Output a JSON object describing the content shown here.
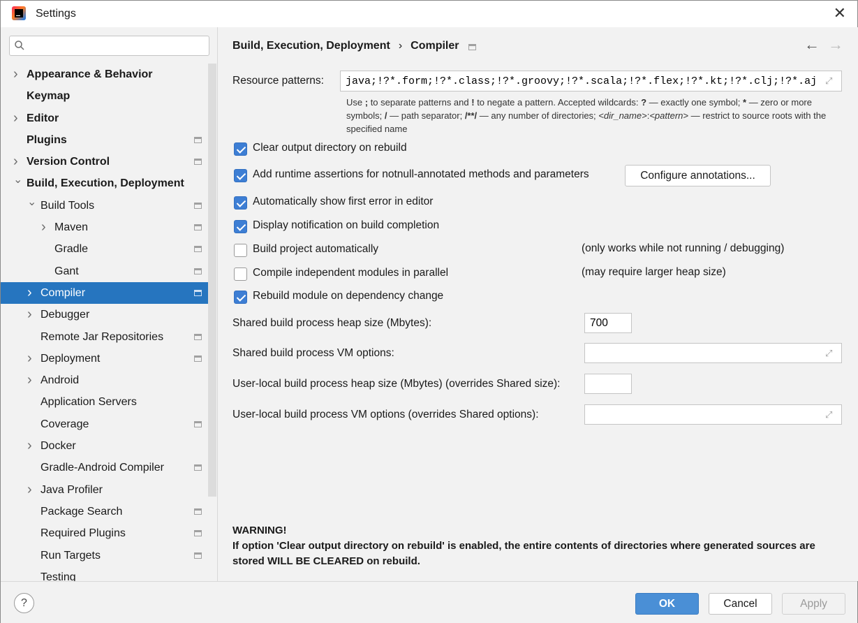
{
  "window": {
    "title": "Settings"
  },
  "sidebar": {
    "search": {
      "value": "",
      "placeholder": ""
    },
    "items": [
      {
        "label": "Appearance & Behavior",
        "level": 0,
        "expandable": true,
        "expanded": false,
        "bold": true,
        "project": false,
        "selected": false
      },
      {
        "label": "Keymap",
        "level": 0,
        "expandable": false,
        "bold": true,
        "project": false,
        "selected": false
      },
      {
        "label": "Editor",
        "level": 0,
        "expandable": true,
        "expanded": false,
        "bold": true,
        "project": false,
        "selected": false
      },
      {
        "label": "Plugins",
        "level": 0,
        "expandable": false,
        "bold": true,
        "project": true,
        "selected": false
      },
      {
        "label": "Version Control",
        "level": 0,
        "expandable": true,
        "expanded": false,
        "bold": true,
        "project": true,
        "selected": false
      },
      {
        "label": "Build, Execution, Deployment",
        "level": 0,
        "expandable": true,
        "expanded": true,
        "bold": true,
        "project": false,
        "selected": false
      },
      {
        "label": "Build Tools",
        "level": 1,
        "expandable": true,
        "expanded": true,
        "bold": false,
        "project": true,
        "selected": false
      },
      {
        "label": "Maven",
        "level": 2,
        "expandable": true,
        "expanded": false,
        "bold": false,
        "project": true,
        "selected": false
      },
      {
        "label": "Gradle",
        "level": 2,
        "expandable": false,
        "bold": false,
        "project": true,
        "selected": false
      },
      {
        "label": "Gant",
        "level": 2,
        "expandable": false,
        "bold": false,
        "project": true,
        "selected": false
      },
      {
        "label": "Compiler",
        "level": 1,
        "expandable": true,
        "expanded": false,
        "bold": false,
        "project": true,
        "selected": true
      },
      {
        "label": "Debugger",
        "level": 1,
        "expandable": true,
        "expanded": false,
        "bold": false,
        "project": false,
        "selected": false
      },
      {
        "label": "Remote Jar Repositories",
        "level": 1,
        "expandable": false,
        "bold": false,
        "project": true,
        "selected": false
      },
      {
        "label": "Deployment",
        "level": 1,
        "expandable": true,
        "expanded": false,
        "bold": false,
        "project": true,
        "selected": false
      },
      {
        "label": "Android",
        "level": 1,
        "expandable": true,
        "expanded": false,
        "bold": false,
        "project": false,
        "selected": false
      },
      {
        "label": "Application Servers",
        "level": 1,
        "expandable": false,
        "bold": false,
        "project": false,
        "selected": false
      },
      {
        "label": "Coverage",
        "level": 1,
        "expandable": false,
        "bold": false,
        "project": true,
        "selected": false
      },
      {
        "label": "Docker",
        "level": 1,
        "expandable": true,
        "expanded": false,
        "bold": false,
        "project": false,
        "selected": false
      },
      {
        "label": "Gradle-Android Compiler",
        "level": 1,
        "expandable": false,
        "bold": false,
        "project": true,
        "selected": false
      },
      {
        "label": "Java Profiler",
        "level": 1,
        "expandable": true,
        "expanded": false,
        "bold": false,
        "project": false,
        "selected": false
      },
      {
        "label": "Package Search",
        "level": 1,
        "expandable": false,
        "bold": false,
        "project": true,
        "selected": false
      },
      {
        "label": "Required Plugins",
        "level": 1,
        "expandable": false,
        "bold": false,
        "project": true,
        "selected": false
      },
      {
        "label": "Run Targets",
        "level": 1,
        "expandable": false,
        "bold": false,
        "project": true,
        "selected": false
      },
      {
        "label": "Testing",
        "level": 1,
        "expandable": false,
        "bold": false,
        "project": false,
        "selected": false
      }
    ]
  },
  "breadcrumb": {
    "parent": "Build, Execution, Deployment",
    "separator": "›",
    "current": "Compiler"
  },
  "nav": {
    "back": "←",
    "forward": "→"
  },
  "resource_patterns": {
    "label": "Resource patterns:",
    "value": "java;!?*.form;!?*.class;!?*.groovy;!?*.scala;!?*.flex;!?*.kt;!?*.clj;!?*.aj"
  },
  "hint": {
    "p1": "Use ",
    "b1": ";",
    "p2": " to separate patterns and ",
    "b2": "!",
    "p3": " to negate a pattern. Accepted wildcards: ",
    "b3": "?",
    "p4": " — exactly one symbol; ",
    "b4": "*",
    "p5": " — zero or more symbols; ",
    "b5": "/",
    "p6": " — path separator; ",
    "b6": "/**/",
    "p7": " — any number of directories; ",
    "i1": "<dir_name>",
    "p8": ":",
    "i2": "<pattern>",
    "p9": " — restrict to source roots with the specified name"
  },
  "options": {
    "clear_output": {
      "label": "Clear output directory on rebuild",
      "checked": true
    },
    "runtime_assertions": {
      "label": "Add runtime assertions for notnull-annotated methods and parameters",
      "checked": true
    },
    "configure_annotations": "Configure annotations...",
    "show_first_error": {
      "label": "Automatically show first error in editor",
      "checked": true
    },
    "display_notification": {
      "label": "Display notification on build completion",
      "checked": true
    },
    "build_automatically": {
      "label": "Build project automatically",
      "checked": false,
      "note": "(only works while not running / debugging)"
    },
    "compile_parallel": {
      "label": "Compile independent modules in parallel",
      "checked": false,
      "note": "(may require larger heap size)"
    },
    "rebuild_on_dependency": {
      "label": "Rebuild module on dependency change",
      "checked": true
    }
  },
  "fields": {
    "shared_heap": {
      "label": "Shared build process heap size (Mbytes):",
      "value": "700"
    },
    "shared_vm": {
      "label": "Shared build process VM options:",
      "value": ""
    },
    "user_heap": {
      "label": "User-local build process heap size (Mbytes) (overrides Shared size):",
      "value": ""
    },
    "user_vm": {
      "label": "User-local build process VM options (overrides Shared options):",
      "value": ""
    }
  },
  "warning": {
    "title": "WARNING!",
    "text": "If option 'Clear output directory on rebuild' is enabled, the entire contents of directories where generated sources are stored WILL BE CLEARED on rebuild."
  },
  "footer": {
    "help": "?",
    "ok": "OK",
    "cancel": "Cancel",
    "apply": "Apply"
  },
  "colors": {
    "selection": "#2675bf",
    "checkbox": "#3d7ed4",
    "primary_button": "#4a8fd6"
  }
}
